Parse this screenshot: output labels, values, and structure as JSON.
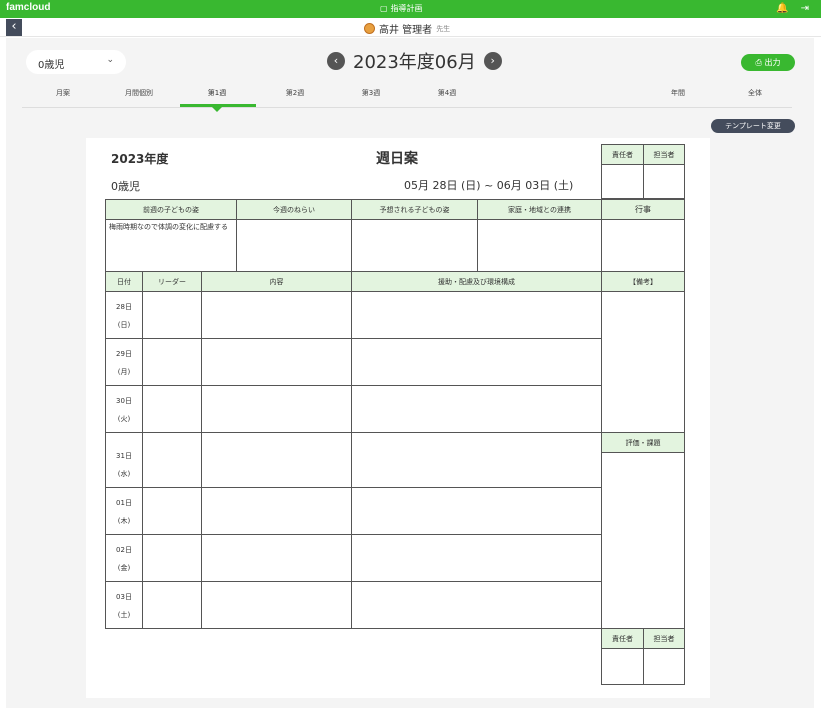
{
  "topbar": {
    "brand": "famcloud",
    "center_label": "指導計画",
    "bell_icon": "bell-icon",
    "logout_icon": "logout-icon"
  },
  "user": {
    "name": "高井 管理者",
    "role": "先生"
  },
  "controls": {
    "age": "0歳児",
    "period": "2023年度06月",
    "export": "出力",
    "template": "テンプレート変更"
  },
  "tabs": [
    {
      "label": "月案"
    },
    {
      "label": "月間個別"
    },
    {
      "label": "第1週"
    },
    {
      "label": "第2週"
    },
    {
      "label": "第3週"
    },
    {
      "label": "第4週"
    },
    {
      "label": "年間"
    },
    {
      "label": "全体"
    }
  ],
  "document": {
    "year": "2023年度",
    "title": "週日案",
    "age": "0歳児",
    "range": "05月 28日 (日) ~ 06月 03日 (土)",
    "sign_headers": [
      "責任者",
      "担当者"
    ],
    "section_headers": [
      "前週の子どもの姿",
      "今週のねらい",
      "予想される子どもの姿",
      "家庭・地域との連携",
      "行事"
    ],
    "previous_week_note": "梅雨時期なので体調の変化に配慮する",
    "daily_headers": [
      "日付",
      "リーダー",
      "内容",
      "援助・配慮及び環境構成",
      "【備考】"
    ],
    "evaluation_header": "評価・課題",
    "days": [
      {
        "date": "28日",
        "weekday": "(日)"
      },
      {
        "date": "29日",
        "weekday": "(月)"
      },
      {
        "date": "30日",
        "weekday": "(火)"
      },
      {
        "date": "31日",
        "weekday": "(水)"
      },
      {
        "date": "01日",
        "weekday": "(木)"
      },
      {
        "date": "02日",
        "weekday": "(金)"
      },
      {
        "date": "03日",
        "weekday": "(土)"
      }
    ]
  }
}
